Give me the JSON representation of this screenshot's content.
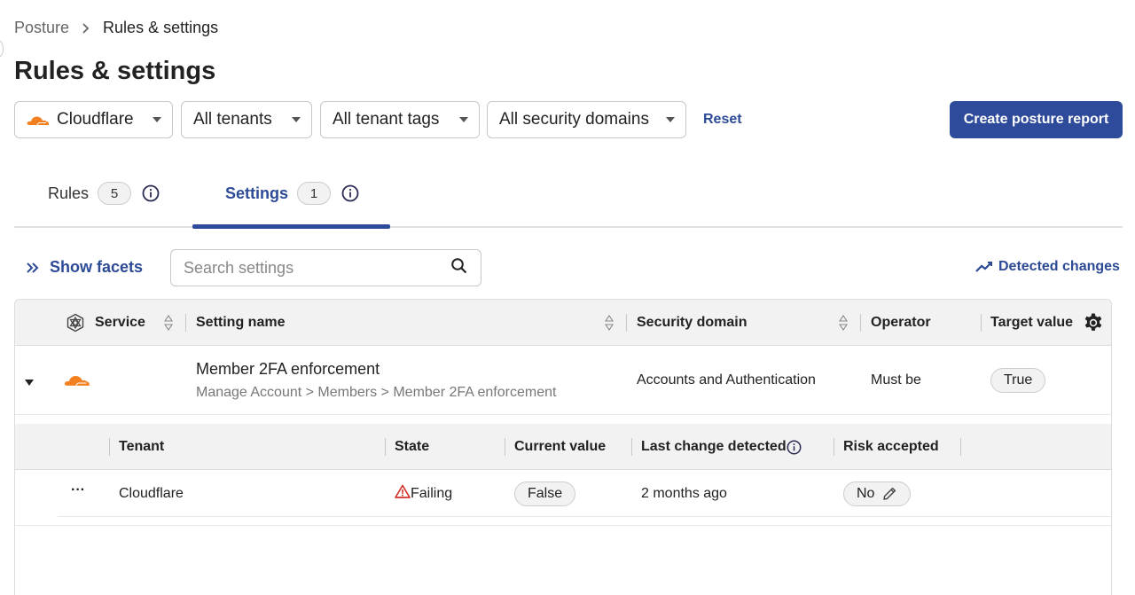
{
  "breadcrumb": {
    "parent": "Posture",
    "current": "Rules & settings"
  },
  "page": {
    "title": "Rules & settings"
  },
  "filters": {
    "provider": "Cloudflare",
    "tenants": "All tenants",
    "tenant_tags": "All tenant tags",
    "security_domains": "All security domains",
    "reset_label": "Reset"
  },
  "actions": {
    "create_report": "Create posture report"
  },
  "tabs": [
    {
      "label": "Rules",
      "count": "5",
      "active": false
    },
    {
      "label": "Settings",
      "count": "1",
      "active": true
    }
  ],
  "toolbar": {
    "show_facets": "Show facets",
    "search_placeholder": "Search settings",
    "detected_changes": "Detected changes"
  },
  "table": {
    "columns": [
      "Service",
      "Setting name",
      "Security domain",
      "Operator",
      "Target value"
    ],
    "rows": [
      {
        "setting_name": "Member 2FA enforcement",
        "setting_path": "Manage Account > Members > Member 2FA enforcement",
        "security_domain": "Accounts and Authentication",
        "operator": "Must be",
        "target_value": "True"
      }
    ],
    "sub_columns": [
      "Tenant",
      "State",
      "Current value",
      "Last change detected",
      "Risk accepted"
    ],
    "sub_rows": [
      {
        "more": "···",
        "tenant": "Cloudflare",
        "state": "Failing",
        "current_value": "False",
        "last_change": "2 months ago",
        "risk_accepted": "No"
      }
    ]
  },
  "colors": {
    "accent": "#2d4b9a",
    "link": "#2c4a96",
    "cloudflare_orange": "#f38020",
    "failing_red": "#d0342c"
  }
}
